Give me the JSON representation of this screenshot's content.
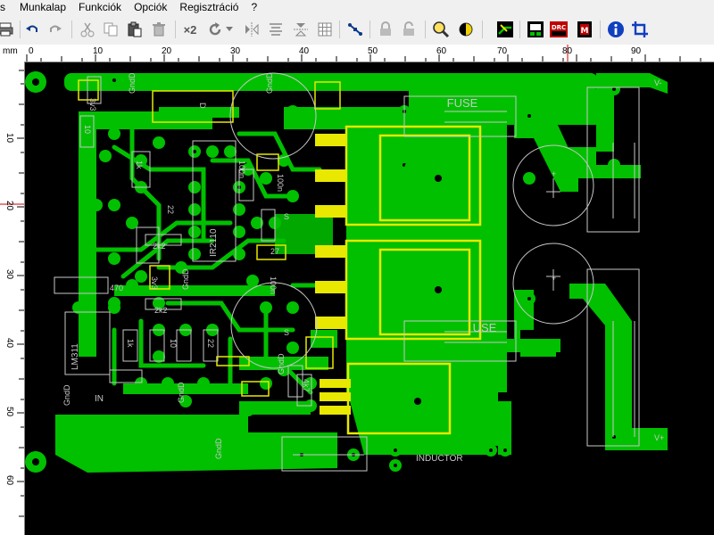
{
  "menu": {
    "items": [
      "s",
      "Munkalap",
      "Funkciók",
      "Opciók",
      "Regisztráció",
      "?"
    ]
  },
  "toolbar": {
    "duplicate_label": "×2"
  },
  "ruler": {
    "unit": "mm",
    "h_ticks": [
      "0",
      "10",
      "20",
      "30",
      "40",
      "50",
      "60",
      "70",
      "80",
      "90"
    ],
    "v_ticks": [
      "10",
      "20",
      "30",
      "40",
      "50",
      "60"
    ]
  },
  "board": {
    "labels": {
      "fuse_top": "FUSE",
      "fuse_bottom": "USE",
      "inductor": "INDUCTOR",
      "ic_lm311": "LM311",
      "ic_ir2110": "IR2110",
      "in": "IN",
      "gnd": "GndD",
      "v_top": "V-",
      "v_bottom": "V+",
      "r_470": "470",
      "r_2k2": "2k2",
      "r_27": "27",
      "r_10": "10",
      "r_1k": "1k",
      "r_3v3": "3v3",
      "r_4k7": "4k7",
      "r_100n": "100n",
      "r_22": "22",
      "s": "S",
      "d": "D"
    }
  },
  "colors": {
    "copper": "#00c000",
    "silk": "#c8c8c8",
    "pad_yellow": "#e8e800",
    "background": "#000000"
  }
}
